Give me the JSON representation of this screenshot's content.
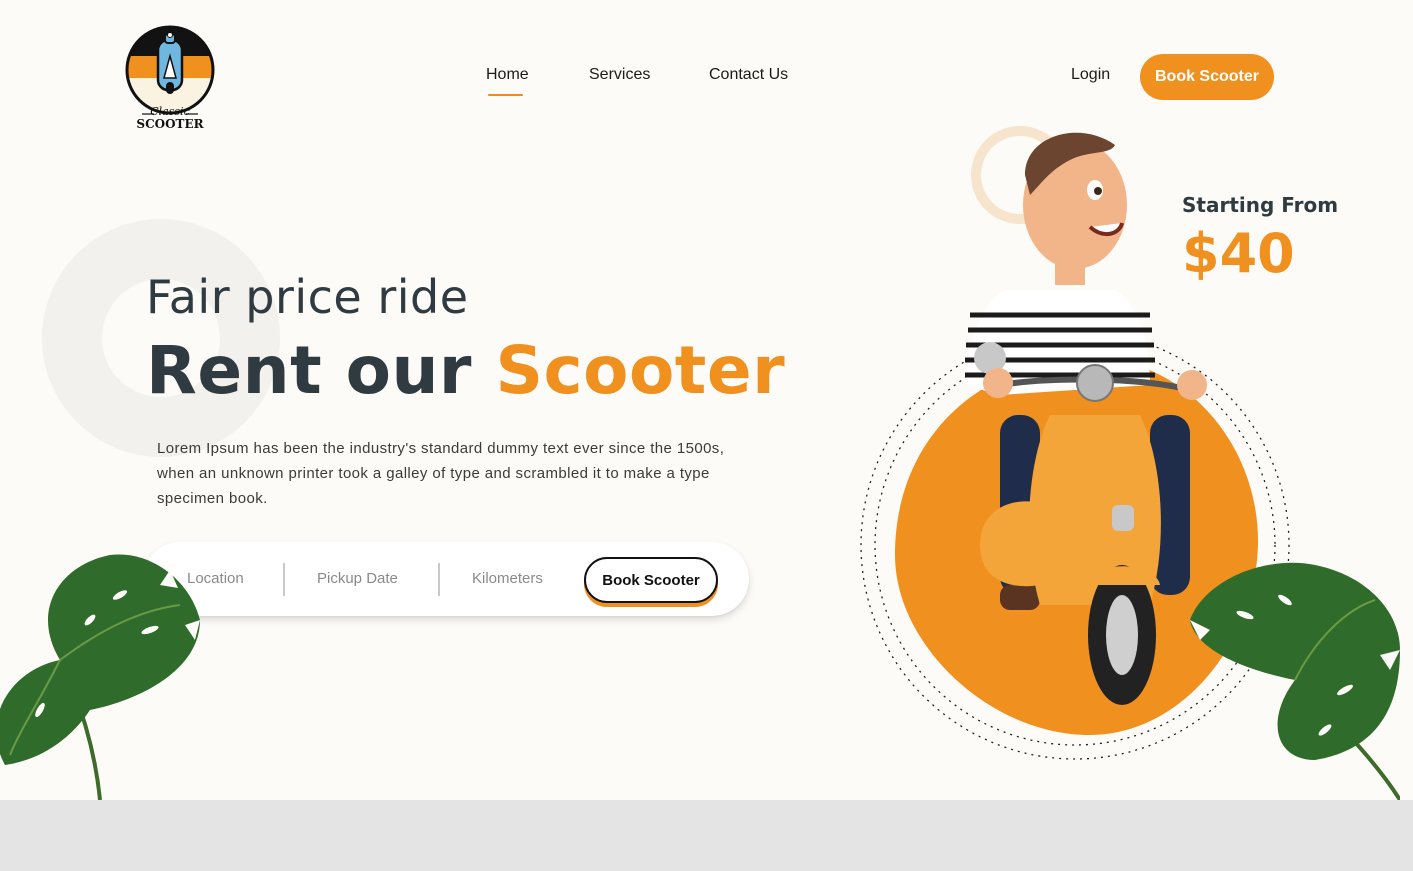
{
  "brand": {
    "logo_text_top": "Classic",
    "logo_text_bottom": "SCOOTER"
  },
  "nav": {
    "items": [
      {
        "label": "Home",
        "active": true
      },
      {
        "label": "Services",
        "active": false
      },
      {
        "label": "Contact Us",
        "active": false
      }
    ]
  },
  "header": {
    "login_label": "Login",
    "cta_label": "Book Scooter"
  },
  "hero": {
    "subtitle": "Fair price ride",
    "title_main": "Rent our",
    "title_accent": "Scooter",
    "description": "Lorem Ipsum has been the industry's standard dummy text ever since the 1500s, when an unknown printer took a galley of type and scrambled it to make a type specimen book."
  },
  "booking": {
    "location_label": "Location",
    "pickup_label": "Pickup Date",
    "kilometers_label": "Kilometers",
    "button_label": "Book Scooter"
  },
  "price": {
    "label": "Starting From",
    "value": "$40"
  },
  "colors": {
    "accent": "#f0901f",
    "dark_text": "#2f3b40",
    "page_bg": "#fdfbf7",
    "leaf_green": "#2f6b2a"
  },
  "icons": [
    "scooter-logo-icon",
    "rider-on-scooter-illustration",
    "monstera-leaf-icon"
  ]
}
